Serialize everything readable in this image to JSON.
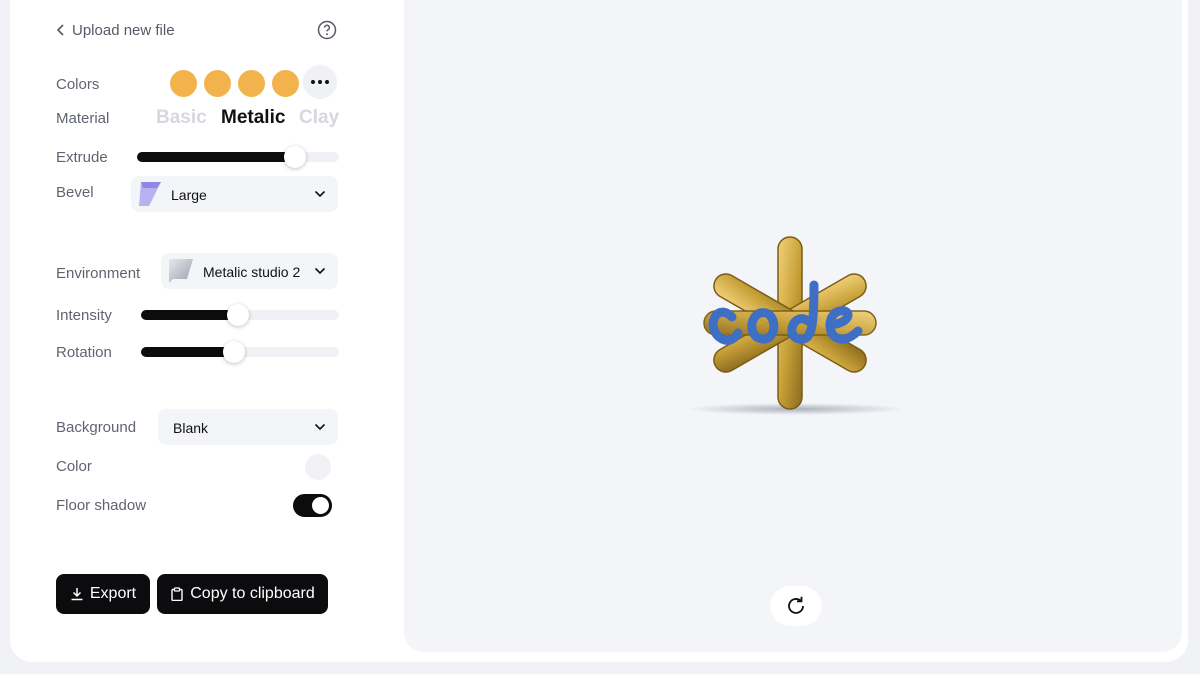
{
  "header": {
    "back_label": "Upload new file",
    "help_icon": "question-circle-icon"
  },
  "colors": {
    "label": "Colors",
    "swatches": [
      "#f3b34c",
      "#f3b34c",
      "#f3b34c",
      "#f3b34c"
    ],
    "more_icon": "more-horizontal-icon"
  },
  "material": {
    "label": "Material",
    "options": [
      "Basic",
      "Metalic",
      "Clay"
    ],
    "selected": "Metalic"
  },
  "extrude": {
    "label": "Extrude",
    "value": 0.78
  },
  "bevel": {
    "label": "Bevel",
    "value": "Large"
  },
  "environment": {
    "label": "Environment",
    "value": "Metalic studio 2"
  },
  "intensity": {
    "label": "Intensity",
    "value": 0.49
  },
  "rotation": {
    "label": "Rotation",
    "value": 0.47
  },
  "background": {
    "label": "Background",
    "value": "Blank"
  },
  "color": {
    "label": "Color",
    "swatch": "#f1f2f6"
  },
  "floor_shadow": {
    "label": "Floor shadow",
    "enabled": true
  },
  "actions": {
    "export_label": "Export",
    "copy_label": "Copy to clipboard"
  },
  "preview": {
    "model_colors": {
      "gold": "#c9a23a",
      "blue": "#3f6fc4"
    },
    "refresh_icon": "refresh-icon"
  }
}
